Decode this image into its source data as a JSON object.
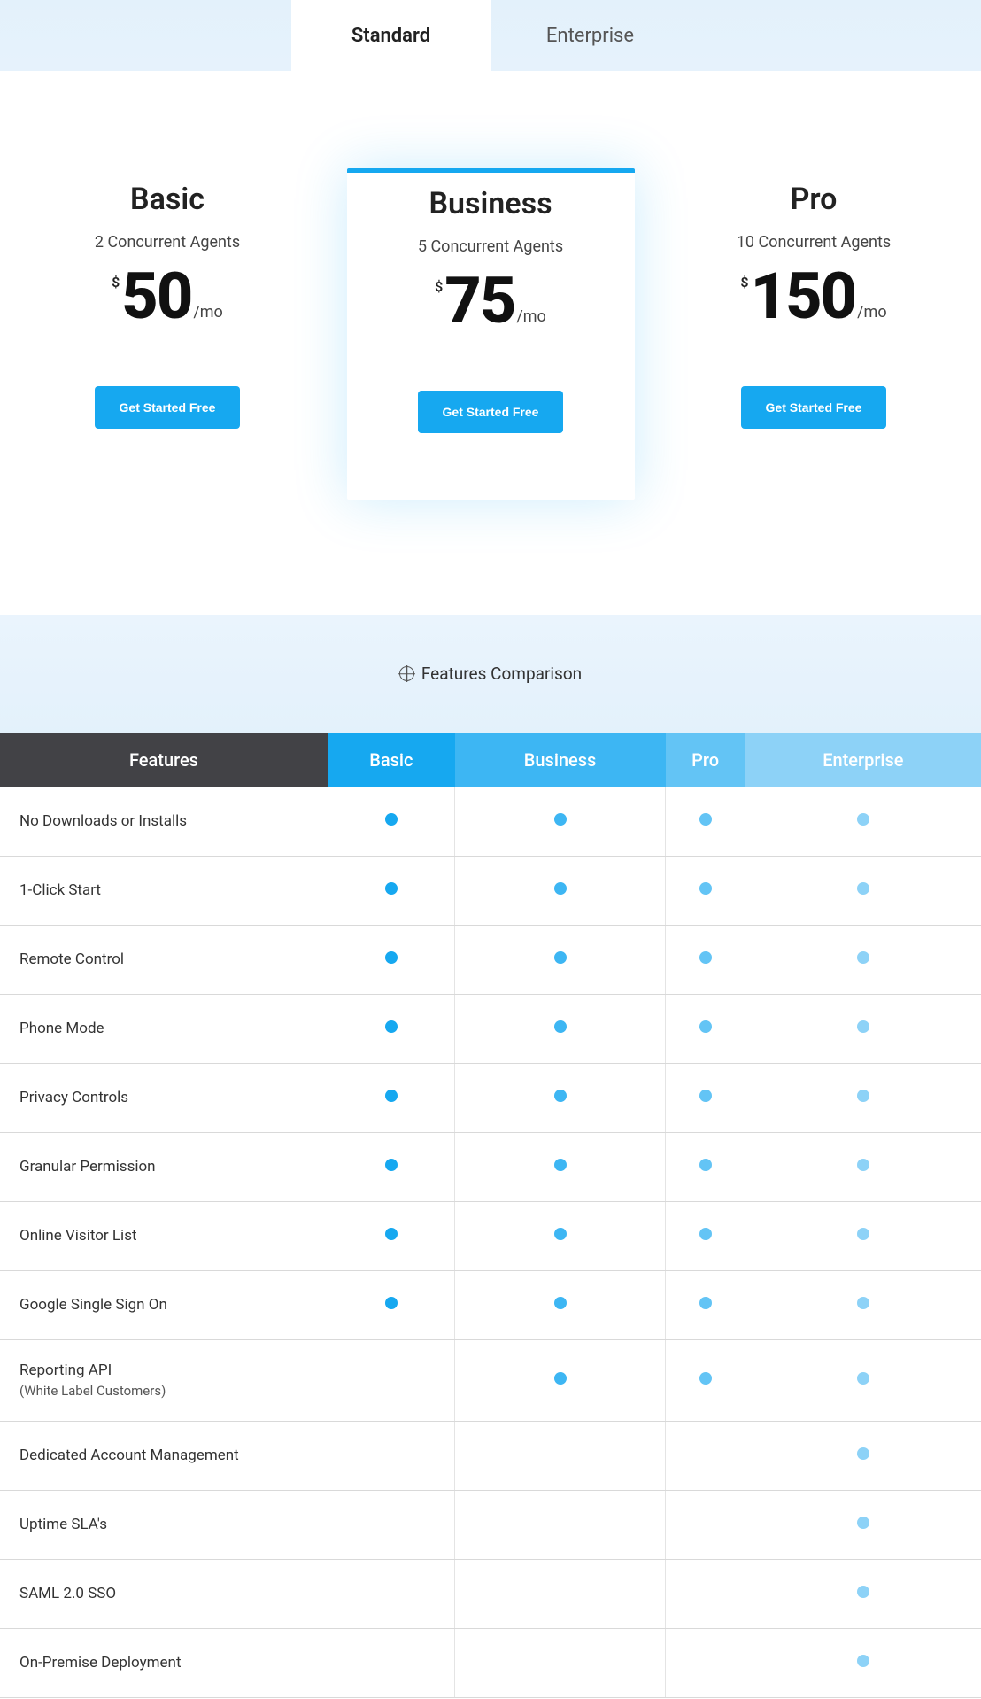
{
  "tabs": {
    "standard": "Standard",
    "enterprise": "Enterprise"
  },
  "plans": [
    {
      "name": "Basic",
      "sub": "2 Concurrent Agents",
      "currency": "$",
      "price": "50",
      "period": "/mo",
      "cta": "Get Started Free"
    },
    {
      "name": "Business",
      "sub": "5 Concurrent Agents",
      "currency": "$",
      "price": "75",
      "period": "/mo",
      "cta": "Get Started Free"
    },
    {
      "name": "Pro",
      "sub": "10 Concurrent Agents",
      "currency": "$",
      "price": "150",
      "period": "/mo",
      "cta": "Get Started Free"
    }
  ],
  "comparison_title": "Features Comparison",
  "table": {
    "headers": {
      "features": "Features",
      "basic": "Basic",
      "business": "Business",
      "pro": "Pro",
      "enterprise": "Enterprise"
    },
    "rows": [
      {
        "label": "No Downloads or Installs",
        "basic": true,
        "business": true,
        "pro": true,
        "enterprise": true
      },
      {
        "label": "1-Click Start",
        "basic": true,
        "business": true,
        "pro": true,
        "enterprise": true
      },
      {
        "label": "Remote Control",
        "basic": true,
        "business": true,
        "pro": true,
        "enterprise": true
      },
      {
        "label": "Phone Mode",
        "basic": true,
        "business": true,
        "pro": true,
        "enterprise": true
      },
      {
        "label": "Privacy Controls",
        "basic": true,
        "business": true,
        "pro": true,
        "enterprise": true
      },
      {
        "label": "Granular Permission",
        "basic": true,
        "business": true,
        "pro": true,
        "enterprise": true
      },
      {
        "label": "Online Visitor List",
        "basic": true,
        "business": true,
        "pro": true,
        "enterprise": true
      },
      {
        "label": "Google Single Sign On",
        "basic": true,
        "business": true,
        "pro": true,
        "enterprise": true
      },
      {
        "label": "Reporting API",
        "sub": "(White Label Customers)",
        "basic": false,
        "business": true,
        "pro": true,
        "enterprise": true
      },
      {
        "label": "Dedicated Account Management",
        "basic": false,
        "business": false,
        "pro": false,
        "enterprise": true
      },
      {
        "label": "Uptime SLA's",
        "basic": false,
        "business": false,
        "pro": false,
        "enterprise": true
      },
      {
        "label": "SAML 2.0 SSO",
        "basic": false,
        "business": false,
        "pro": false,
        "enterprise": true
      },
      {
        "label": "On-Premise Deployment",
        "basic": false,
        "business": false,
        "pro": false,
        "enterprise": true
      }
    ]
  }
}
